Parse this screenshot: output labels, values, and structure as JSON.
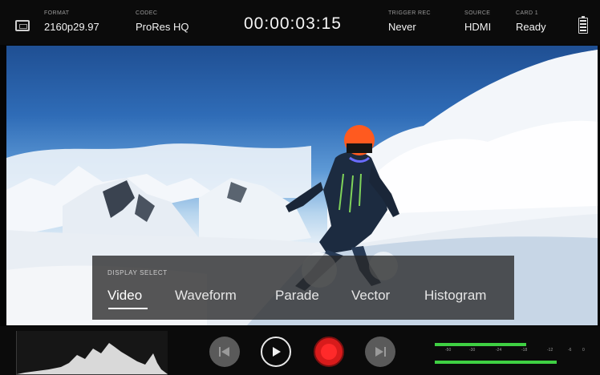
{
  "topbar": {
    "format": {
      "label": "FORMAT",
      "value": "2160p29.97",
      "icon": "monitor-icon"
    },
    "codec": {
      "label": "CODEC",
      "value": "ProRes HQ"
    },
    "timecode": "00:00:03:15",
    "trigger": {
      "label": "TRIGGER REC",
      "value": "Never"
    },
    "source": {
      "label": "SOURCE",
      "value": "HDMI"
    },
    "card": {
      "label": "CARD 1",
      "value": "Ready"
    },
    "battery_icon": "battery-icon"
  },
  "display_select": {
    "title": "DISPLAY SELECT",
    "options": [
      "Video",
      "Waveform",
      "Parade",
      "Vector",
      "Histogram"
    ],
    "selected": "Video"
  },
  "transport": {
    "prev_icon": "skip-previous-icon",
    "play_icon": "play-icon",
    "record_icon": "record-icon",
    "next_icon": "skip-next-icon"
  },
  "audio_meters": {
    "scale": [
      "-50",
      "-30",
      "-24",
      "-18",
      "-12",
      "-6",
      "0"
    ],
    "channel_levels": [
      0.6,
      0.8
    ]
  },
  "colors": {
    "record": "#d81b1b",
    "meter": "#3fd043",
    "background": "#0b0b0b"
  }
}
